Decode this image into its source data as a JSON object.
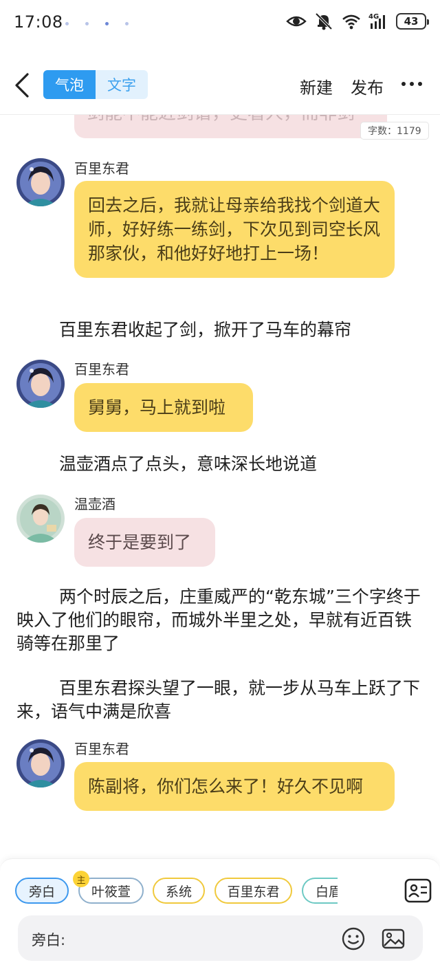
{
  "status_bar": {
    "time": "17:08",
    "battery": "43",
    "network": "4G",
    "icons": [
      "eye-icon",
      "bell-off-icon",
      "wifi-icon",
      "signal-icon",
      "battery-icon"
    ]
  },
  "toolbar": {
    "tabs": [
      {
        "label": "气泡",
        "active": true
      },
      {
        "label": "文字",
        "active": false
      }
    ],
    "new_label": "新建",
    "publish_label": "发布",
    "accent_color": "#2e9bf0"
  },
  "chat": {
    "cut_text": "剑能不能近剑谱，更看人，而非剑",
    "word_count": "字数：1179",
    "messages": [
      {
        "kind": "bubble",
        "speaker": "百里东君",
        "text": "回去之后，我就让母亲给我找个剑道大师，好好练一练剑，下次见到司空长风那家伙，和他好好地打上一场！",
        "color": "#fddc6a"
      },
      {
        "kind": "narration",
        "text": "百里东君收起了剑，掀开了马车的幕帘"
      },
      {
        "kind": "bubble",
        "speaker": "百里东君",
        "text": "舅舅，马上就到啦",
        "color": "#fddc6a"
      },
      {
        "kind": "narration",
        "text": "温壶酒点了点头，意味深长地说道"
      },
      {
        "kind": "bubble",
        "speaker": "温壶酒",
        "text": "终于是要到了",
        "color": "#f6e1e3"
      },
      {
        "kind": "narration",
        "text": "两个时辰之后，庄重威严的“乾东城”三个字终于映入了他们的眼帘，而城外半里之处，早就有近百铁骑等在那里了"
      },
      {
        "kind": "narration",
        "text": "百里东君探头望了一眼，就一步从马车上跃了下来，语气中满是欣喜"
      },
      {
        "kind": "bubble",
        "speaker": "百里东君",
        "text": "陈副将，你们怎么来了！好久不见啊",
        "color": "#fddc6a"
      }
    ]
  },
  "bottom_panel": {
    "roles": [
      "旁白",
      "叶筱萱",
      "系统",
      "百里东君",
      "白眉"
    ],
    "main_badge": "主",
    "input_label": "旁白:"
  }
}
